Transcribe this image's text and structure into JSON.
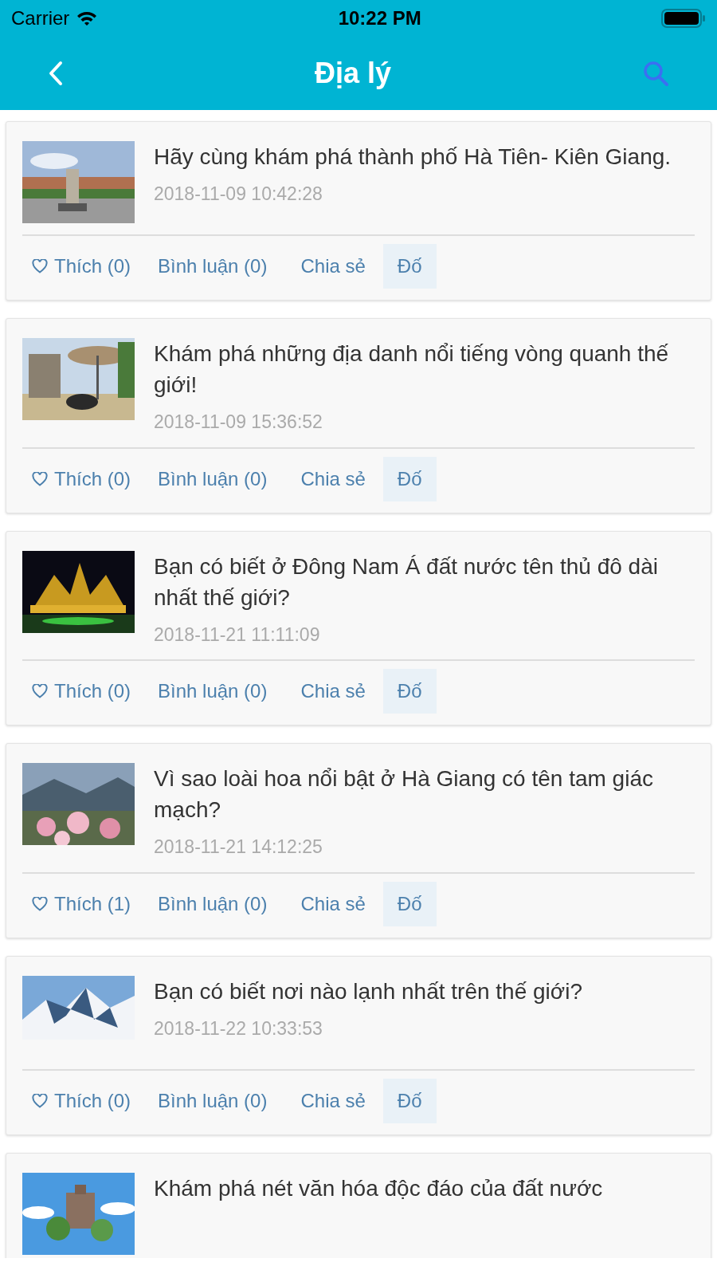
{
  "status_bar": {
    "carrier": "Carrier",
    "time": "10:22 PM"
  },
  "header": {
    "title": "Địa lý"
  },
  "posts": [
    {
      "title": "Hãy cùng khám phá thành phố Hà Tiên- Kiên Giang.",
      "date": "2018-11-09 10:42:28",
      "actions": {
        "like": "Thích (0)",
        "comment": "Bình luận (0)",
        "share": "Chia sẻ",
        "quiz": "Đố"
      }
    },
    {
      "title": "Khám phá những địa danh nổi tiếng vòng quanh thế giới!",
      "date": "2018-11-09 15:36:52",
      "actions": {
        "like": "Thích (0)",
        "comment": "Bình luận (0)",
        "share": "Chia sẻ",
        "quiz": "Đố"
      }
    },
    {
      "title": " Bạn có biết ở Đông Nam Á đất nước tên thủ đô dài nhất thế giới?",
      "date": "2018-11-21 11:11:09",
      "actions": {
        "like": "Thích (0)",
        "comment": "Bình luận (0)",
        "share": "Chia sẻ",
        "quiz": "Đố"
      }
    },
    {
      "title": "Vì sao loài hoa nổi bật ở Hà Giang có tên tam giác mạch?",
      "date": "2018-11-21 14:12:25",
      "actions": {
        "like": "Thích (1)",
        "comment": "Bình luận (0)",
        "share": "Chia sẻ",
        "quiz": "Đố"
      }
    },
    {
      "title": "Bạn có biết nơi nào lạnh nhất trên thế giới?",
      "date": "2018-11-22 10:33:53",
      "actions": {
        "like": "Thích (0)",
        "comment": "Bình luận (0)",
        "share": "Chia sẻ",
        "quiz": "Đố"
      }
    },
    {
      "title": "Khám phá nét văn hóa độc đáo của đất nước"
    }
  ]
}
